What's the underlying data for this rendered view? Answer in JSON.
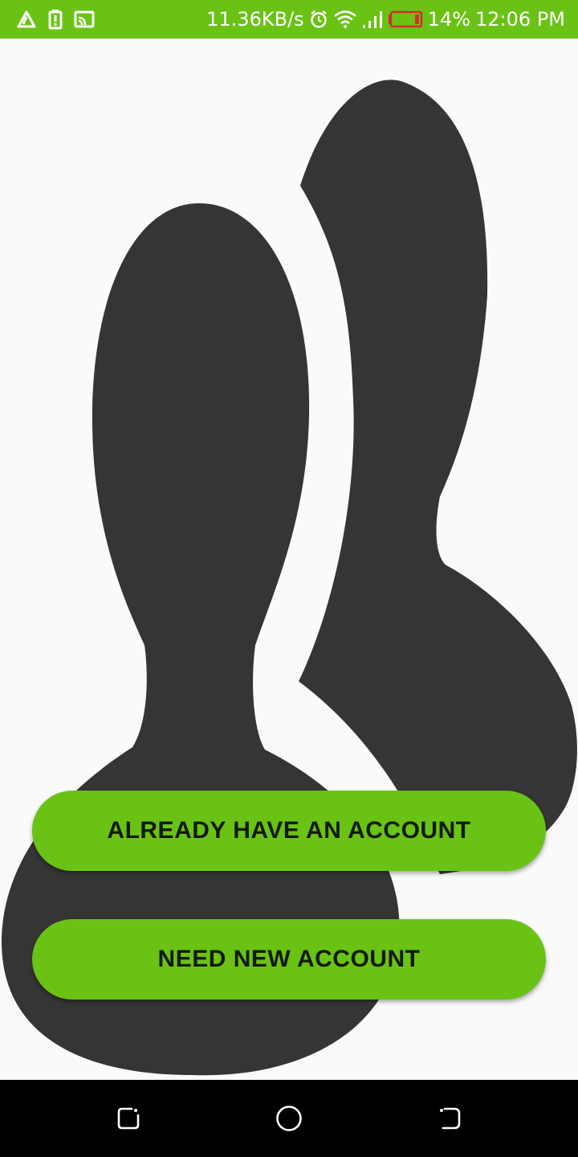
{
  "status_bar": {
    "network_speed": "11.36KB/s",
    "battery_percent": "14%",
    "time": "12:06 PM",
    "background_color": "#6ac314",
    "left_icons": [
      "alert-triangle-icon",
      "battery-alert-icon",
      "cast-icon"
    ],
    "right_icons": [
      "alarm-icon",
      "wifi-icon",
      "signal-icon",
      "battery-low-icon"
    ]
  },
  "main": {
    "illustration": "users-silhouette-icon",
    "buttons": {
      "login_label": "ALREADY HAVE AN ACCOUNT",
      "signup_label": "NEED NEW ACCOUNT"
    },
    "accent_color": "#6ac314",
    "silhouette_color": "#353535"
  },
  "nav_bar": {
    "icons": [
      "recent-apps-icon",
      "home-icon",
      "back-icon"
    ]
  }
}
